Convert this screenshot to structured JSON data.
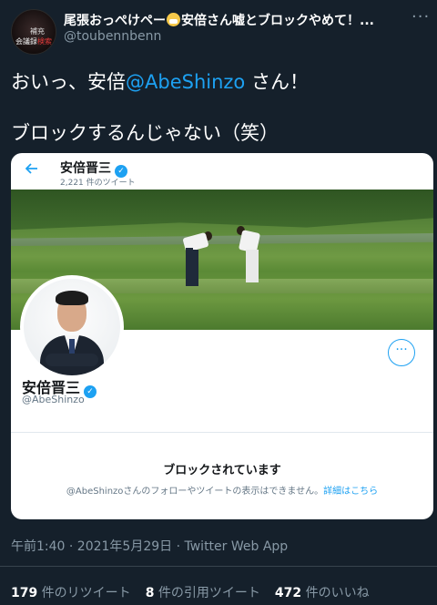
{
  "tweet": {
    "author_display_name": "尾張おっぺけペー",
    "author_display_name_rest": "安倍さん嘘とブロックやめて！...",
    "author_handle": "@toubennbenn",
    "avatar_text_top": "補充",
    "avatar_text_bottom_a": "会議録",
    "avatar_text_bottom_b": "検索",
    "text_line1_before": "おいっ、安倍",
    "text_mention": "@AbeShinzo",
    "text_line1_after": " さん！",
    "text_line2": "ブロックするんじゃない（笑）",
    "timestamp": "午前1:40 · 2021年5月29日 · Twitter Web App",
    "stats": {
      "retweets_count": "179",
      "retweets_label": " 件のリツイート",
      "quotes_count": "8",
      "quotes_label": " 件の引用ツイート",
      "likes_count": "472",
      "likes_label": " 件のいいね"
    }
  },
  "embedded_screenshot": {
    "back_icon": "arrow-left-icon",
    "header_name": "安倍晋三",
    "header_tweet_count": "2,221 件のツイート",
    "profile_name": "安倍晋三",
    "profile_handle": "@AbeShinzo",
    "more_button": "···",
    "blocked_title": "ブロックされています",
    "blocked_desc": "@AbeShinzoさんのフォローやツイートの表示はできません。",
    "blocked_link": "詳細はこちら",
    "verified_mark": "✓"
  },
  "more_icon": "···",
  "colors": {
    "background": "#15202b",
    "accent": "#1da1f2",
    "secondary_text": "#8899a6"
  }
}
